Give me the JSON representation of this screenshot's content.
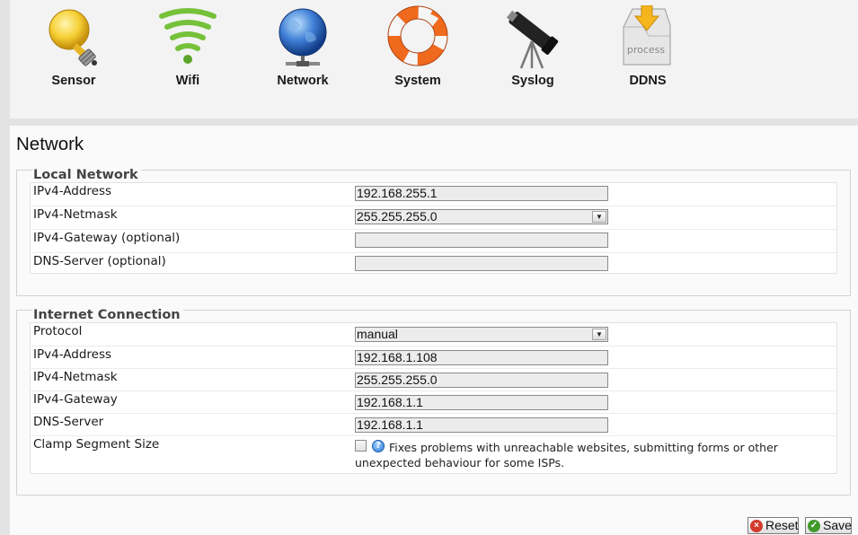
{
  "nav": {
    "items": [
      {
        "label": "Sensor",
        "icon": "lightbulb-icon"
      },
      {
        "label": "Wifi",
        "icon": "wifi-icon"
      },
      {
        "label": "Network",
        "icon": "globe-network-icon"
      },
      {
        "label": "System",
        "icon": "lifebuoy-icon"
      },
      {
        "label": "Syslog",
        "icon": "telescope-icon"
      },
      {
        "label": "DDNS",
        "icon": "process-icon",
        "icon_text": "process"
      }
    ]
  },
  "page": {
    "title": "Network"
  },
  "local_network": {
    "legend": "Local Network",
    "ipv4_address": {
      "label": "IPv4-Address",
      "value": "192.168.255.1"
    },
    "ipv4_netmask": {
      "label": "IPv4-Netmask",
      "value": "255.255.255.0"
    },
    "ipv4_gateway": {
      "label": "IPv4-Gateway (optional)",
      "value": ""
    },
    "dns_server": {
      "label": "DNS-Server (optional)",
      "value": ""
    }
  },
  "internet_connection": {
    "legend": "Internet Connection",
    "protocol": {
      "label": "Protocol",
      "value": "manual"
    },
    "ipv4_address": {
      "label": "IPv4-Address",
      "value": "192.168.1.108"
    },
    "ipv4_netmask": {
      "label": "IPv4-Netmask",
      "value": "255.255.255.0"
    },
    "ipv4_gateway": {
      "label": "IPv4-Gateway",
      "value": "192.168.1.1"
    },
    "dns_server": {
      "label": "DNS-Server",
      "value": "192.168.1.1"
    },
    "clamp": {
      "label": "Clamp Segment Size",
      "checked": false,
      "help": "Fixes problems with unreachable websites, submitting forms or other unexpected behaviour for some ISPs."
    }
  },
  "actions": {
    "reset": "Reset",
    "save": "Save"
  },
  "colors": {
    "page_bg": "#e3e3e3",
    "panel_bg": "#fafafa",
    "field_bg": "#ececec",
    "reset_icon": "#d23a2c",
    "save_icon": "#3f9a2a"
  }
}
